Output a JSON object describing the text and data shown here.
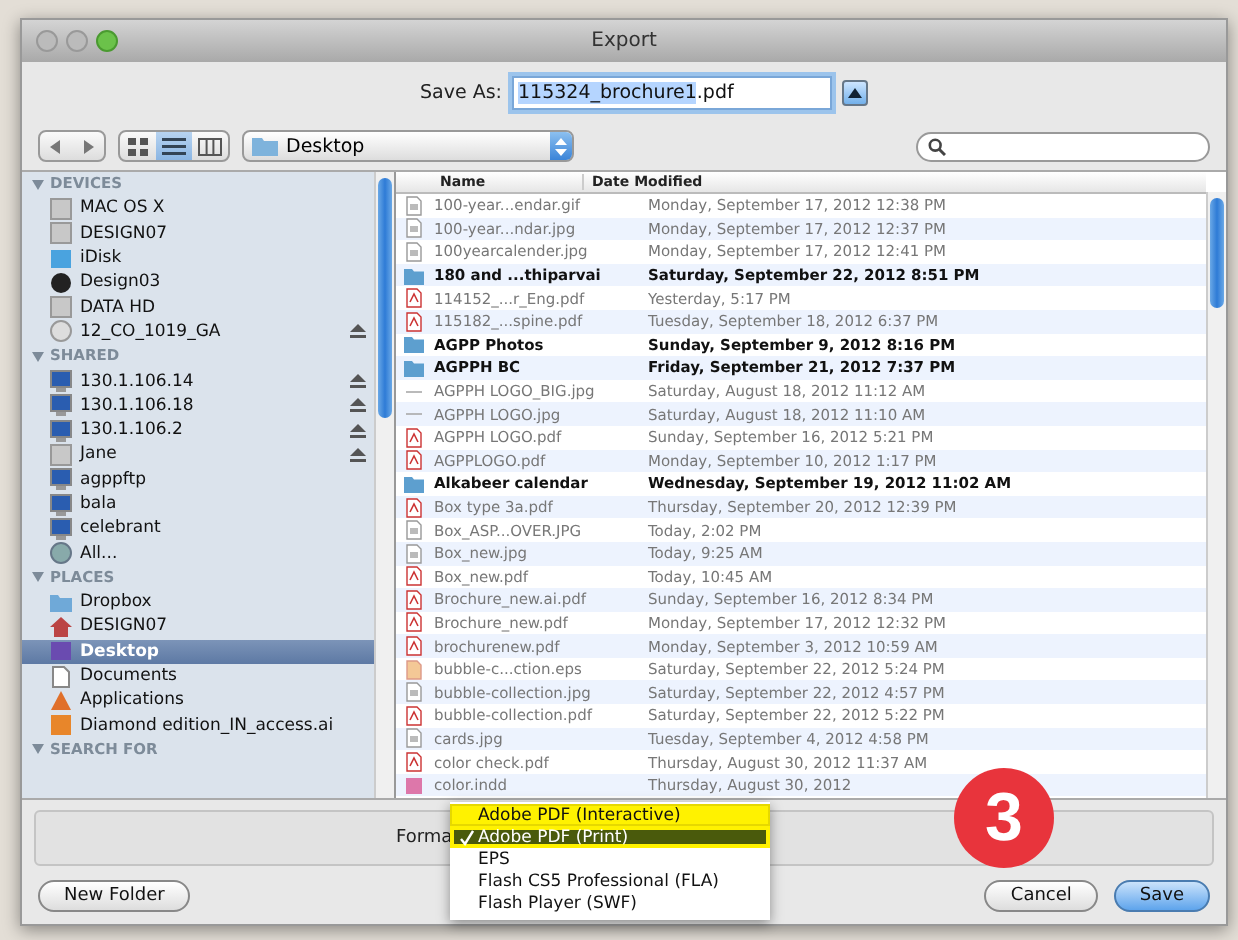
{
  "window": {
    "title": "Export"
  },
  "save_as": {
    "label": "Save As:",
    "selected_text": "115324_brochure1",
    "text": ".pdf"
  },
  "views": [
    {
      "kind": "icons",
      "selected": false
    },
    {
      "kind": "list",
      "selected": true
    },
    {
      "kind": "columns",
      "selected": false
    }
  ],
  "location": {
    "value": "Desktop"
  },
  "sidebar": [
    {
      "title": "DEVICES",
      "items": [
        {
          "label": "MAC OS X",
          "kind": "drive",
          "eject": false,
          "selected": false
        },
        {
          "label": "DESIGN07",
          "kind": "drive",
          "eject": false,
          "selected": false
        },
        {
          "label": "iDisk",
          "kind": "idisk",
          "eject": false,
          "selected": false
        },
        {
          "label": "Design03",
          "kind": "disk",
          "eject": false,
          "selected": false
        },
        {
          "label": "DATA HD",
          "kind": "drive",
          "eject": false,
          "selected": false
        },
        {
          "label": "12_CO_1019_GA",
          "kind": "cd",
          "eject": true,
          "selected": false
        }
      ]
    },
    {
      "title": "SHARED",
      "items": [
        {
          "label": "130.1.106.14",
          "kind": "computer",
          "eject": true,
          "selected": false
        },
        {
          "label": "130.1.106.18",
          "kind": "computer",
          "eject": true,
          "selected": false
        },
        {
          "label": "130.1.106.2",
          "kind": "computer",
          "eject": true,
          "selected": false
        },
        {
          "label": "Jane",
          "kind": "drive",
          "eject": true,
          "selected": false
        },
        {
          "label": "agppftp",
          "kind": "computer",
          "eject": false,
          "selected": false
        },
        {
          "label": "bala",
          "kind": "computer",
          "eject": false,
          "selected": false
        },
        {
          "label": "celebrant",
          "kind": "computer",
          "eject": false,
          "selected": false
        },
        {
          "label": "All...",
          "kind": "globe",
          "eject": false,
          "selected": false
        }
      ]
    },
    {
      "title": "PLACES",
      "items": [
        {
          "label": "Dropbox",
          "kind": "folder",
          "eject": false,
          "selected": false
        },
        {
          "label": "DESIGN07",
          "kind": "home",
          "eject": false,
          "selected": false
        },
        {
          "label": "Desktop",
          "kind": "desktop",
          "eject": false,
          "selected": true
        },
        {
          "label": "Documents",
          "kind": "document",
          "eject": false,
          "selected": false
        },
        {
          "label": "Applications",
          "kind": "apps",
          "eject": false,
          "selected": false
        },
        {
          "label": "Diamond edition_IN_access.ai",
          "kind": "ai",
          "eject": false,
          "selected": false
        }
      ]
    },
    {
      "title": "SEARCH FOR"
    }
  ],
  "file_list": {
    "columns": [
      "Name",
      "Date Modified"
    ],
    "rows": [
      {
        "name": "100-year...endar.gif",
        "date": "Monday, September 17, 2012 12:38 PM",
        "kind": "image"
      },
      {
        "name": "100-year...ndar.jpg",
        "date": "Monday, September 17, 2012 12:37 PM",
        "kind": "image"
      },
      {
        "name": "100yearcalender.jpg",
        "date": "Monday, September 17, 2012 12:41 PM",
        "kind": "image"
      },
      {
        "name": "180 and ...thiparvai",
        "date": "Saturday, September 22, 2012 8:51 PM",
        "kind": "folder"
      },
      {
        "name": "114152_...r_Eng.pdf",
        "date": "Yesterday, 5:17 PM",
        "kind": "pdf"
      },
      {
        "name": "115182_...spine.pdf",
        "date": "Tuesday, September 18, 2012 6:37 PM",
        "kind": "pdf"
      },
      {
        "name": "AGPP Photos",
        "date": "Sunday, September 9, 2012 8:16 PM",
        "kind": "folder"
      },
      {
        "name": "AGPPH BC",
        "date": "Friday, September 21, 2012 7:37 PM",
        "kind": "folder"
      },
      {
        "name": "AGPPH LOGO_BIG.jpg",
        "date": "Saturday, August 18, 2012 11:12 AM",
        "kind": "dash"
      },
      {
        "name": "AGPPH LOGO.jpg",
        "date": "Saturday, August 18, 2012 11:10 AM",
        "kind": "dash"
      },
      {
        "name": "AGPPH LOGO.pdf",
        "date": "Sunday, September 16, 2012 5:21 PM",
        "kind": "pdf"
      },
      {
        "name": "AGPPLOGO.pdf",
        "date": "Monday, September 10, 2012 1:17 PM",
        "kind": "pdf"
      },
      {
        "name": "Alkabeer calendar",
        "date": "Wednesday, September 19, 2012 11:02 AM",
        "kind": "folder"
      },
      {
        "name": "Box type 3a.pdf",
        "date": "Thursday, September 20, 2012 12:39 PM",
        "kind": "pdf"
      },
      {
        "name": "Box_ASP...OVER.JPG",
        "date": "Today, 2:02 PM",
        "kind": "image"
      },
      {
        "name": "Box_new.jpg",
        "date": "Today, 9:25 AM",
        "kind": "image"
      },
      {
        "name": "Box_new.pdf",
        "date": "Today, 10:45 AM",
        "kind": "pdf"
      },
      {
        "name": "Brochure_new.ai.pdf",
        "date": "Sunday, September 16, 2012 8:34 PM",
        "kind": "pdf"
      },
      {
        "name": "Brochure_new.pdf",
        "date": "Monday, September 17, 2012 12:32 PM",
        "kind": "pdf"
      },
      {
        "name": "brochurenew.pdf",
        "date": "Monday, September 3, 2012 10:59 AM",
        "kind": "pdf"
      },
      {
        "name": "bubble-c...ction.eps",
        "date": "Saturday, September 22, 2012 5:24 PM",
        "kind": "eps"
      },
      {
        "name": "bubble-collection.jpg",
        "date": "Saturday, September 22, 2012 4:57 PM",
        "kind": "image"
      },
      {
        "name": "bubble-collection.pdf",
        "date": "Saturday, September 22, 2012 5:22 PM",
        "kind": "pdf"
      },
      {
        "name": "cards.jpg",
        "date": "Tuesday, September 4, 2012 4:58 PM",
        "kind": "image"
      },
      {
        "name": "color check.pdf",
        "date": "Thursday, August 30, 2012 11:37 AM",
        "kind": "pdf"
      },
      {
        "name": "color.indd",
        "date": "Thursday, August 30, 2012",
        "kind": "indd"
      }
    ]
  },
  "format": {
    "label": "Forma",
    "menu": [
      {
        "label": "Adobe PDF (Interactive)",
        "selected": false,
        "highlighted": true
      },
      {
        "label": "Adobe PDF (Print)",
        "selected": true,
        "highlighted": true
      },
      {
        "label": "EPS",
        "selected": false,
        "highlighted": false
      },
      {
        "label": "Flash CS5 Professional (FLA)",
        "selected": false,
        "highlighted": false
      },
      {
        "label": "Flash Player (SWF)",
        "selected": false,
        "highlighted": false
      }
    ]
  },
  "step_badge": "3",
  "buttons": {
    "new_folder": "New Folder",
    "cancel": "Cancel",
    "save": "Save"
  }
}
